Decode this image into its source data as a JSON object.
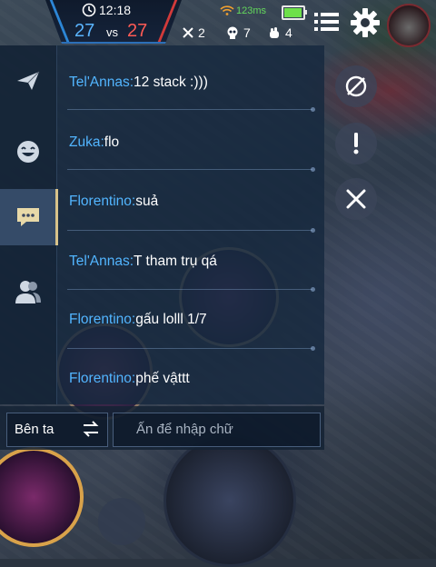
{
  "hud": {
    "time": "12:18",
    "score_blue": "27",
    "vs": "vs",
    "score_red": "27",
    "ping": "123ms",
    "battery_level": 0.85,
    "kills": "2",
    "deaths": "7",
    "assists": "4",
    "colors": {
      "blue": "#5ab4ff",
      "red": "#ff5a55",
      "ping": "#63d85c"
    }
  },
  "chat": {
    "tabs": [
      {
        "icon": "paper-plane-icon"
      },
      {
        "icon": "emoji-icon"
      },
      {
        "icon": "chat-bubble-icon",
        "active": true
      },
      {
        "icon": "friends-icon"
      }
    ],
    "messages": [
      {
        "sender": "Tel'Annas:",
        "text": "12 stack :)))"
      },
      {
        "sender": "Zuka:",
        "text": "flo"
      },
      {
        "sender": "Florentino:",
        "text": "suả"
      },
      {
        "sender": "Tel'Annas:",
        "text": "T tham trụ qá"
      },
      {
        "sender": "Florentino:",
        "text": "gấu lolll 1/7"
      },
      {
        "sender": "Florentino:",
        "text": "phế vậttt"
      }
    ],
    "channel": "Bên ta",
    "input_placeholder": "Ấn để nhập chữ"
  },
  "side_buttons": [
    {
      "icon": "map-toggle-icon"
    },
    {
      "icon": "alert-icon"
    },
    {
      "icon": "close-icon"
    }
  ]
}
